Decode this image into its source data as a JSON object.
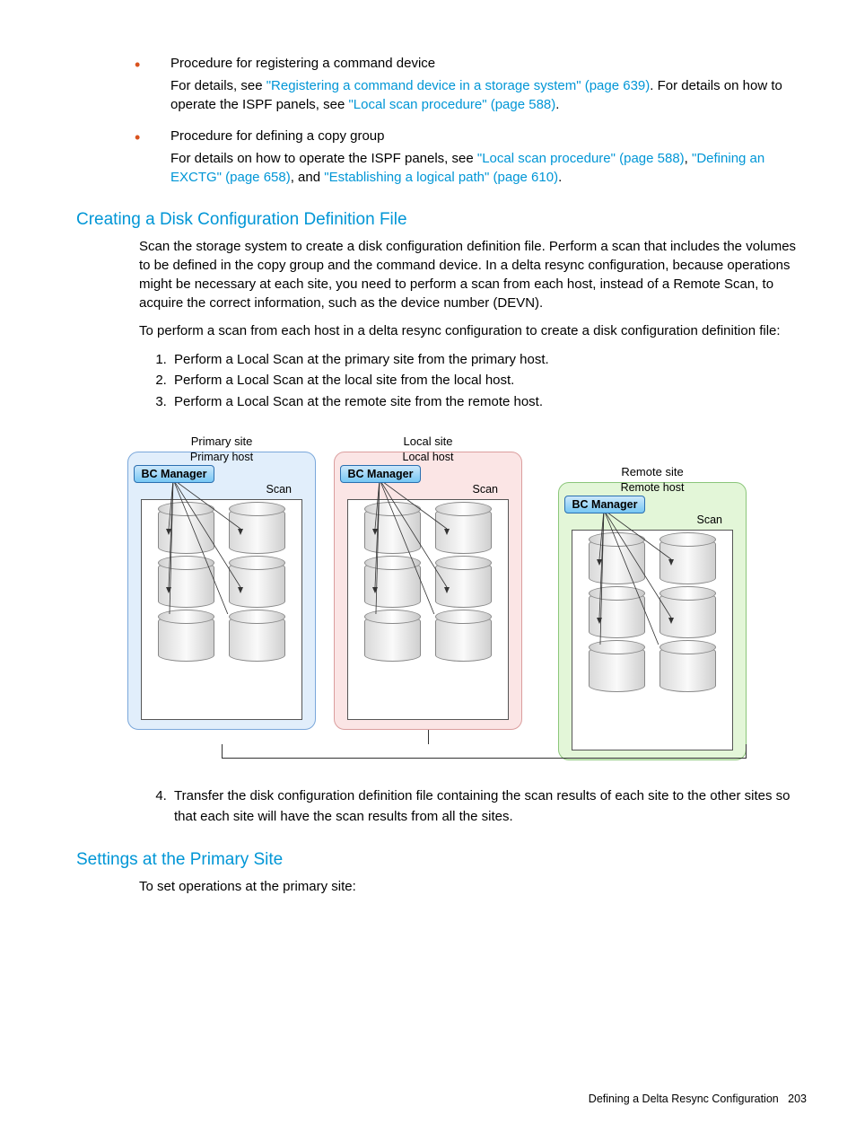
{
  "bullets": [
    {
      "title": "Procedure for registering a command device",
      "pieces": [
        {
          "t": "For details, see "
        },
        {
          "t": "\"Registering a command device in a storage system\" (page 639)",
          "link": true
        },
        {
          "t": ". For details on how to operate the ISPF panels, see "
        },
        {
          "t": "\"Local scan procedure\" (page 588)",
          "link": true
        },
        {
          "t": "."
        }
      ]
    },
    {
      "title": "Procedure for defining a copy group",
      "pieces": [
        {
          "t": "For details on how to operate the ISPF panels, see "
        },
        {
          "t": "\"Local scan procedure\" (page 588)",
          "link": true
        },
        {
          "t": ", "
        },
        {
          "t": "\"Defining an EXCTG\" (page 658)",
          "link": true
        },
        {
          "t": ", and "
        },
        {
          "t": "\"Establishing a logical path\" (page 610)",
          "link": true
        },
        {
          "t": "."
        }
      ]
    }
  ],
  "h2a": "Creating a Disk Configuration Definition File",
  "p1": "Scan the storage system to create a disk configuration definition file. Perform a scan that includes the volumes to be defined in the copy group and the command device. In a delta resync configuration, because operations might be necessary at each site, you need to perform a scan from each host, instead of a Remote Scan, to acquire the correct information, such as the device number (DEVN).",
  "p2": "To perform a scan from each host in a delta resync configuration to create a disk configuration definition file:",
  "steps123": [
    "Perform a Local Scan at the primary site from the primary host.",
    "Perform a Local Scan at the local site from the local host.",
    "Perform a Local Scan at the remote site from the remote host."
  ],
  "step4": "Transfer the disk configuration definition file containing the scan results of each site to the other sites so that each site will have the scan results from all the sites.",
  "h2b": "Settings at the Primary Site",
  "p3": "To set operations at the primary site:",
  "diagram": {
    "primary": {
      "site": "Primary site",
      "host": "Primary host",
      "bcm": "BC Manager",
      "scan": "Scan"
    },
    "local": {
      "site": "Local site",
      "host": "Local host",
      "bcm": "BC Manager",
      "scan": "Scan"
    },
    "remote": {
      "site": "Remote site",
      "host": "Remote host",
      "bcm": "BC Manager",
      "scan": "Scan"
    }
  },
  "footer": {
    "title": "Defining a Delta Resync Configuration",
    "page": "203"
  }
}
